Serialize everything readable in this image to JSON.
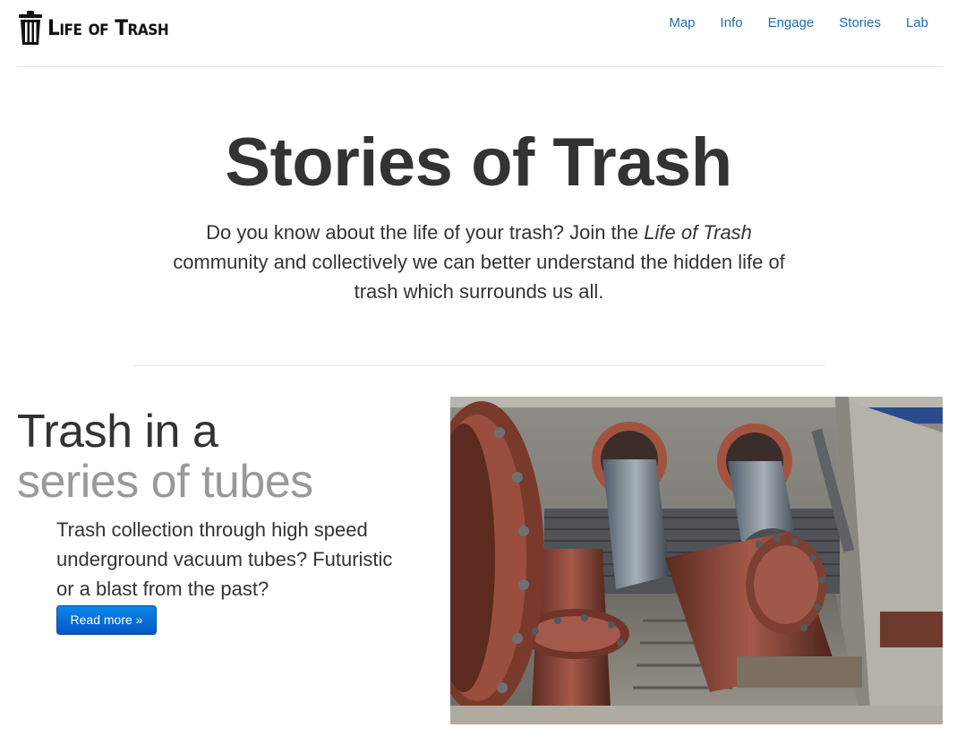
{
  "brand": {
    "name": "Life of Trash",
    "icon": "trash-can-icon"
  },
  "nav": {
    "items": [
      "Map",
      "Info",
      "Engage",
      "Stories",
      "Lab"
    ],
    "link_color": "#1b6db5"
  },
  "hero": {
    "title": "Stories of Trash",
    "lead_before": "Do you know about the life of your trash? Join the ",
    "lead_emphasis": "Life of Trash",
    "lead_after": " community and collectively we can better understand the hidden life of trash which surrounds us all."
  },
  "feature": {
    "heading_line1": "Trash in a",
    "heading_line2": "series of tubes",
    "text": "Trash collection through high speed underground vacuum tubes? Futuristic or a blast from the past?",
    "button_label": "Read more »",
    "image_subject": "rusted-vacuum-tubes-photo",
    "button_color": "#0a6fd8"
  }
}
